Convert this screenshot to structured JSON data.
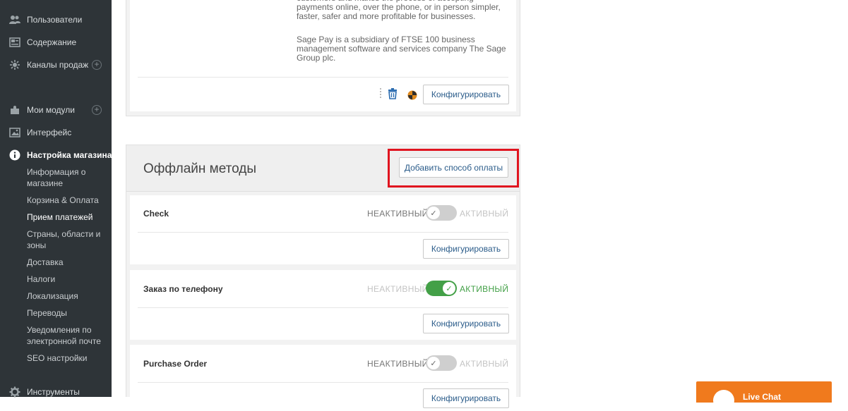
{
  "sidebar": {
    "items": [
      {
        "label": "Пользователи",
        "icon": "users-icon"
      },
      {
        "label": "Содержание",
        "icon": "content-icon"
      },
      {
        "label": "Каналы продаж",
        "icon": "sales-channels-icon"
      },
      {
        "label": "Мои модули",
        "icon": "puzzle-icon"
      },
      {
        "label": "Интерфейс",
        "icon": "image-icon"
      },
      {
        "label": "Настройка магазина",
        "icon": "info-icon"
      },
      {
        "label": "Инструменты",
        "icon": "gear-icon"
      }
    ],
    "subitems": [
      "Информация о магазине",
      "Корзина & Оплата",
      "Прием платежей",
      "Страны, области и зоны",
      "Доставка",
      "Налоги",
      "Локализация",
      "Переводы",
      "Уведомления по электронной почте",
      "SEO настройки"
    ],
    "current_subitem": "Прием платежей"
  },
  "sagepay": {
    "desc_part1": "customers and makes the process of accepting payments online, over the phone, or in person simpler, faster, safer and more profitable for businesses.",
    "desc_part2": "Sage Pay is a subsidiary of FTSE 100 business management software and services company The Sage Group plc.",
    "configure_label": "Конфигурировать"
  },
  "offline": {
    "title": "Оффлайн методы",
    "add_button": "Добавить способ оплаты",
    "inactive_label": "НЕАКТИВНЫЙ",
    "active_label": "АКТИВНЫЙ",
    "methods": [
      {
        "name": "Check",
        "active": false,
        "configure_label": "Конфигурировать"
      },
      {
        "name": "Заказ по телефону",
        "active": true,
        "configure_label": "Конфигурировать"
      },
      {
        "name": "Purchase Order",
        "active": false,
        "configure_label": "Конфигурировать"
      }
    ]
  },
  "livechat": {
    "label": "Live Chat"
  },
  "colors": {
    "sidebar_bg": "#2e3438",
    "toggle_on": "#43a047",
    "toggle_off": "#cfcfcf",
    "link_blue": "#2b5c8a",
    "highlight_red": "#e0141f",
    "livechat_orange": "#f07a1d"
  }
}
